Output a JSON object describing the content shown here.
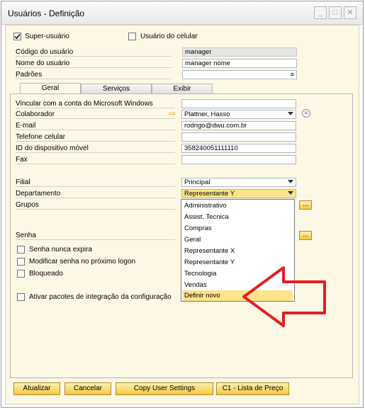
{
  "window": {
    "title": "Usuários - Definição",
    "controls": [
      "minimize-icon",
      "maximize-icon",
      "close-icon"
    ]
  },
  "top": {
    "superuser_label": "Super-usuário",
    "superuser_checked": true,
    "cellular_label": "Usuário do celular",
    "cellular_checked": false,
    "user_code_label": "Código do usuário",
    "user_code_value": "manager",
    "user_name_label": "Nome do usuário",
    "user_name_value": "manager nome",
    "defaults_label": "Padrões",
    "defaults_value": ""
  },
  "tabs": [
    {
      "label": "Geral",
      "active": true
    },
    {
      "label": "Serviços",
      "active": false
    },
    {
      "label": "Exibir",
      "active": false
    }
  ],
  "general": {
    "ms_account_label": "Vincular com a conta do Microsoft Windows",
    "ms_account_value": "",
    "employee_label": "Colaborador",
    "employee_value": "Plattner, Hasso",
    "email_label": "E-mail",
    "email_value": "rodrigo@dwu.com.br",
    "cell_label": "Telefone celular",
    "cell_value": "",
    "device_label": "ID do dispositivo móvel",
    "device_value": "358240051111110",
    "fax_label": "Fax",
    "fax_value": "",
    "branch_label": "Filial",
    "branch_value": "Principal",
    "department_label": "Departamento",
    "department_value": "Representante Y",
    "groups_label": "Grupos",
    "password_label": "Senha",
    "never_expires_label": "Senha nunca expira",
    "change_next_logon_label": "Modificar senha no próximo logon",
    "locked_label": "Bloqueado",
    "enable_integration_label": "Ativar pacotes de integração da configuração"
  },
  "department_options": [
    "Administrativo",
    "Assist. Tecnica",
    "Compras",
    "Geral",
    "Representante X",
    "Representante Y",
    "Tecnologia",
    "Vendas",
    "Definir novo"
  ],
  "highlighted_option": "Definir novo",
  "annotation": {
    "type": "red-arrow",
    "color": "#e02020",
    "points_to": "Definir novo"
  },
  "buttons": {
    "update": "Atualizar",
    "cancel": "Cancelar",
    "copy_user_settings": "Copy User Settings",
    "price_list": "C1 - Lista de Preço"
  },
  "colors": {
    "background": "#fdf8e6",
    "button": "#f5c842",
    "selection": "#fde48a",
    "arrow": "#e02020"
  }
}
